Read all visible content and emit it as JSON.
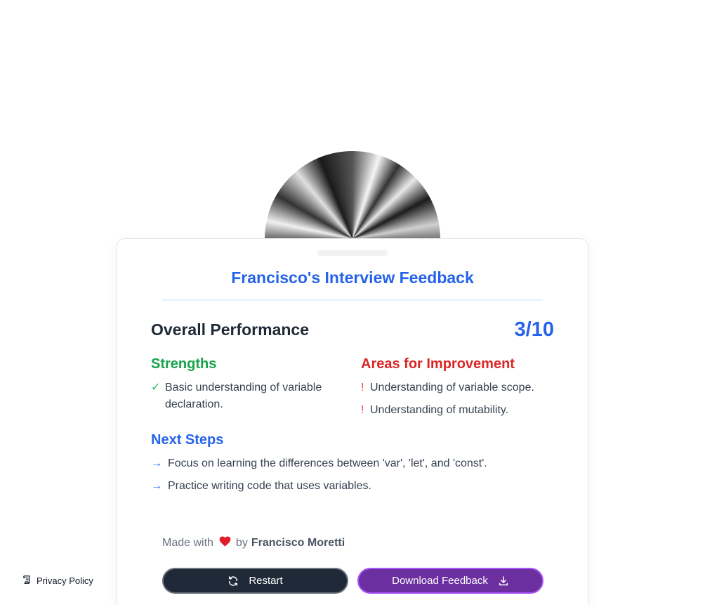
{
  "feedback": {
    "title": "Francisco's Interview Feedback",
    "overall_label": "Overall Performance",
    "score": "3/10",
    "strengths": {
      "title": "Strengths",
      "items": [
        "Basic understanding of variable declaration."
      ]
    },
    "improvements": {
      "title": "Areas for Improvement",
      "items": [
        "Understanding of variable scope.",
        "Understanding of mutability."
      ]
    },
    "next_steps": {
      "title": "Next Steps",
      "items": [
        "Focus on learning the differences between 'var', 'let', and 'const'.",
        "Practice writing code that uses variables."
      ]
    }
  },
  "footer": {
    "made_with": "Made with",
    "by": "by",
    "author": "Francisco Moretti"
  },
  "actions": {
    "restart_label": "Restart",
    "download_label": "Download Feedback"
  },
  "privacy": {
    "label": "Privacy Policy"
  },
  "icons": {
    "check": "✓",
    "bang": "!",
    "arrow": "→",
    "heart": "heart-icon",
    "restart": "refresh-icon",
    "download": "download-icon",
    "privacy": "document-icon"
  },
  "colors": {
    "accent": "#2563eb",
    "strengths": "#16a34a",
    "improvements": "#dc2626",
    "restart_bg": "#1f2937",
    "download_bg": "#6b2fa0"
  }
}
